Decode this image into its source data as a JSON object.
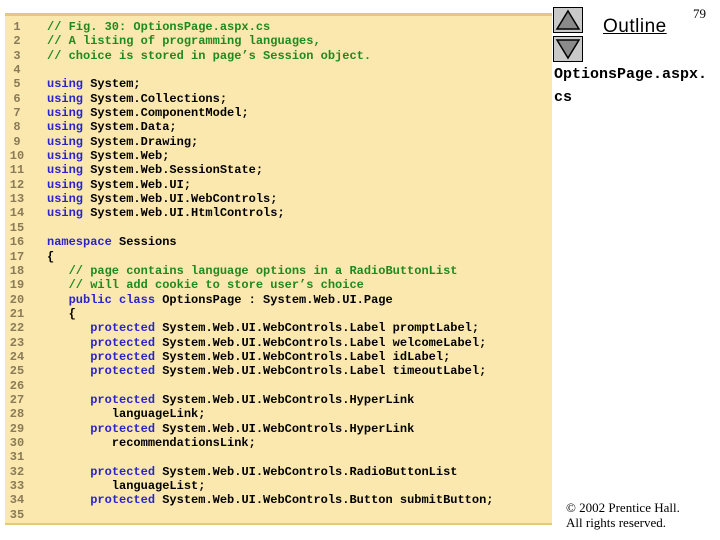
{
  "colors": {
    "panel_bg": "#FBE8AE",
    "panel_edge": "#E3C87E",
    "line_number": "#8A7B58",
    "keyword": "#2A23CC",
    "comment": "#1E8A1E",
    "code": "#000000",
    "button_bg": "#C9C9C9",
    "arrow_fill": "#8A8A8A"
  },
  "header": {
    "page_number": "79",
    "outline_label": "Outline"
  },
  "sidebar": {
    "file_title": "OptionsPage.aspx.cs",
    "copyright": [
      "© 2002 Prentice Hall.",
      "All rights reserved."
    ]
  },
  "code": {
    "lines": [
      {
        "n": "1",
        "seg": [
          [
            "c",
            "// Fig. 30: OptionsPage.aspx.cs"
          ]
        ]
      },
      {
        "n": "2",
        "seg": [
          [
            "c",
            "// A listing of programming languages,"
          ]
        ]
      },
      {
        "n": "3",
        "seg": [
          [
            "c",
            "// choice is stored in page’s Session object."
          ]
        ]
      },
      {
        "n": "4",
        "seg": []
      },
      {
        "n": "5",
        "seg": [
          [
            "k",
            "using"
          ],
          [
            "p",
            " System;"
          ]
        ]
      },
      {
        "n": "6",
        "seg": [
          [
            "k",
            "using"
          ],
          [
            "p",
            " System.Collections;"
          ]
        ]
      },
      {
        "n": "7",
        "seg": [
          [
            "k",
            "using"
          ],
          [
            "p",
            " System.ComponentModel;"
          ]
        ]
      },
      {
        "n": "8",
        "seg": [
          [
            "k",
            "using"
          ],
          [
            "p",
            " System.Data;"
          ]
        ]
      },
      {
        "n": "9",
        "seg": [
          [
            "k",
            "using"
          ],
          [
            "p",
            " System.Drawing;"
          ]
        ]
      },
      {
        "n": "10",
        "seg": [
          [
            "k",
            "using"
          ],
          [
            "p",
            " System.Web;"
          ]
        ]
      },
      {
        "n": "11",
        "seg": [
          [
            "k",
            "using"
          ],
          [
            "p",
            " System.Web.SessionState;"
          ]
        ]
      },
      {
        "n": "12",
        "seg": [
          [
            "k",
            "using"
          ],
          [
            "p",
            " System.Web.UI;"
          ]
        ]
      },
      {
        "n": "13",
        "seg": [
          [
            "k",
            "using"
          ],
          [
            "p",
            " System.Web.UI.WebControls;"
          ]
        ]
      },
      {
        "n": "14",
        "seg": [
          [
            "k",
            "using"
          ],
          [
            "p",
            " System.Web.UI.HtmlControls;"
          ]
        ]
      },
      {
        "n": "15",
        "seg": []
      },
      {
        "n": "16",
        "seg": [
          [
            "k",
            "namespace"
          ],
          [
            "p",
            " Sessions"
          ]
        ]
      },
      {
        "n": "17",
        "seg": [
          [
            "p",
            "{"
          ]
        ]
      },
      {
        "n": "18",
        "seg": [
          [
            "c",
            "   // page contains language options in a RadioButtonList"
          ]
        ]
      },
      {
        "n": "19",
        "seg": [
          [
            "c",
            "   // will add cookie to store user’s choice"
          ]
        ]
      },
      {
        "n": "20",
        "seg": [
          [
            "p",
            "   "
          ],
          [
            "k",
            "public class"
          ],
          [
            "p",
            " OptionsPage : System.Web.UI.Page"
          ]
        ]
      },
      {
        "n": "21",
        "seg": [
          [
            "p",
            "   {"
          ]
        ]
      },
      {
        "n": "22",
        "seg": [
          [
            "p",
            "      "
          ],
          [
            "k",
            "protected"
          ],
          [
            "p",
            " System.Web.UI.WebControls.Label promptLabel;"
          ]
        ]
      },
      {
        "n": "23",
        "seg": [
          [
            "p",
            "      "
          ],
          [
            "k",
            "protected"
          ],
          [
            "p",
            " System.Web.UI.WebControls.Label welcomeLabel;"
          ]
        ]
      },
      {
        "n": "24",
        "seg": [
          [
            "p",
            "      "
          ],
          [
            "k",
            "protected"
          ],
          [
            "p",
            " System.Web.UI.WebControls.Label idLabel;"
          ]
        ]
      },
      {
        "n": "25",
        "seg": [
          [
            "p",
            "      "
          ],
          [
            "k",
            "protected"
          ],
          [
            "p",
            " System.Web.UI.WebControls.Label timeoutLabel;"
          ]
        ]
      },
      {
        "n": "26",
        "seg": []
      },
      {
        "n": "27",
        "seg": [
          [
            "p",
            "      "
          ],
          [
            "k",
            "protected"
          ],
          [
            "p",
            " System.Web.UI.WebControls.HyperLink"
          ]
        ]
      },
      {
        "n": "28",
        "seg": [
          [
            "p",
            "         languageLink;"
          ]
        ]
      },
      {
        "n": "29",
        "seg": [
          [
            "p",
            "      "
          ],
          [
            "k",
            "protected"
          ],
          [
            "p",
            " System.Web.UI.WebControls.HyperLink"
          ]
        ]
      },
      {
        "n": "30",
        "seg": [
          [
            "p",
            "         recommendationsLink;"
          ]
        ]
      },
      {
        "n": "31",
        "seg": []
      },
      {
        "n": "32",
        "seg": [
          [
            "p",
            "      "
          ],
          [
            "k",
            "protected"
          ],
          [
            "p",
            " System.Web.UI.WebControls.RadioButtonList"
          ]
        ]
      },
      {
        "n": "33",
        "seg": [
          [
            "p",
            "         languageList;"
          ]
        ]
      },
      {
        "n": "34",
        "seg": [
          [
            "p",
            "      "
          ],
          [
            "k",
            "protected"
          ],
          [
            "p",
            " System.Web.UI.WebControls.Button submitButton;"
          ]
        ]
      },
      {
        "n": "35",
        "seg": []
      }
    ]
  }
}
